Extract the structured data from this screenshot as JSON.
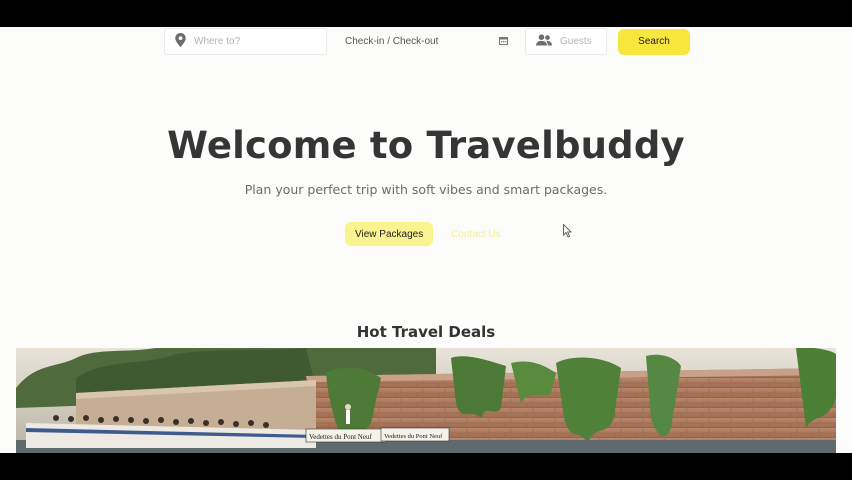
{
  "search": {
    "where_placeholder": "Where to?",
    "dates_label": "Check-in / Check-out",
    "guests_placeholder": "Guests",
    "search_label": "Search"
  },
  "hero": {
    "title": "Welcome to Travelbuddy",
    "subtitle": "Plan your perfect trip with soft vibes and smart packages.",
    "primary_label": "View Packages",
    "secondary_label": "Contact Us"
  },
  "deals": {
    "title": "Hot Travel Deals",
    "image": {
      "sign_text_1": "Vedettes du Pont Neuf",
      "sign_text_2": "Vedettes du Pont Neuf"
    }
  },
  "colors": {
    "accent": "#f7e63b",
    "accent_soft": "#fbf38f",
    "title": "#353535",
    "background": "#fcfcfb"
  },
  "icons": {
    "location": "location-pin-icon",
    "calendar": "calendar-icon",
    "guests": "users-icon",
    "cursor": "mouse-cursor-icon"
  }
}
